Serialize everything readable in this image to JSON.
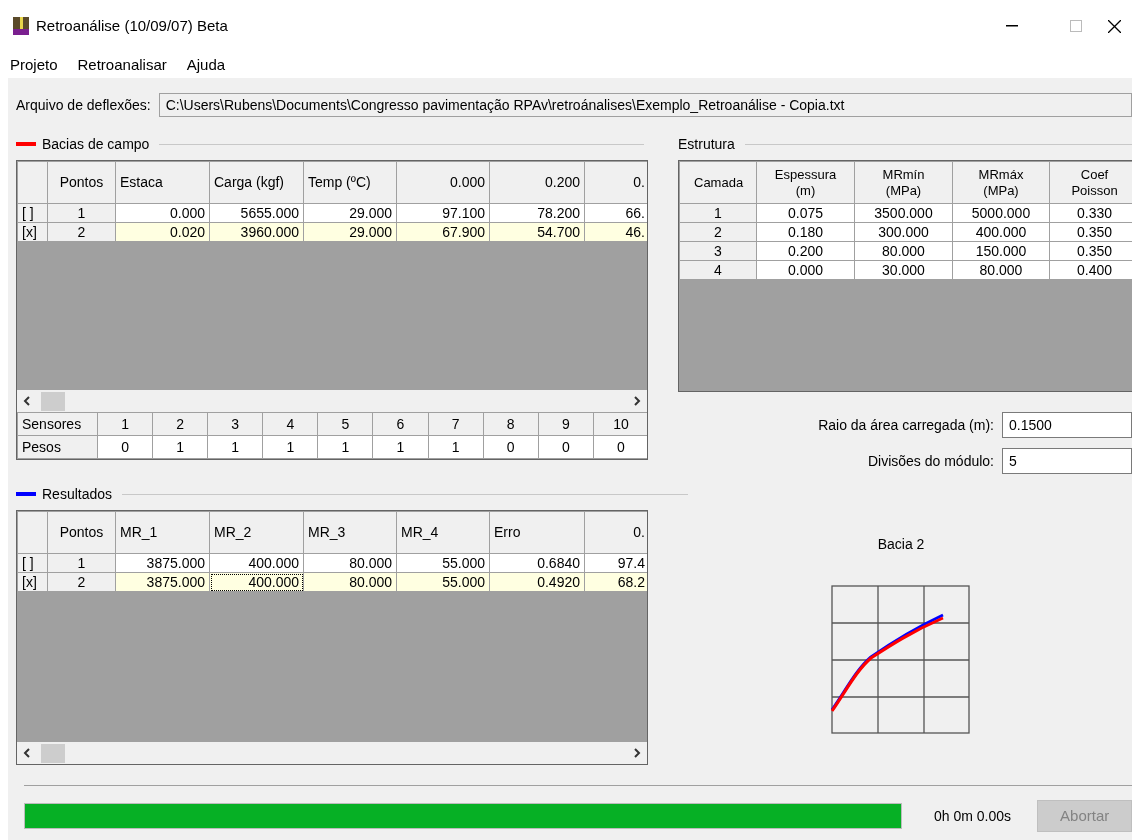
{
  "window": {
    "title": "Retroanálise (10/09/07) Beta"
  },
  "menu": [
    "Projeto",
    "Retroanalisar",
    "Ajuda"
  ],
  "file": {
    "label": "Arquivo de deflexões:",
    "value": "C:\\Users\\Rubens\\Documents\\Congresso pavimentação RPAv\\retroánalises\\Exemplo_Retroanálise - Copia.txt"
  },
  "field_basins": {
    "title": "Bacias de campo",
    "columns": [
      "Pontos",
      "Estaca",
      "Carga (kgf)",
      "Temp (ºC)",
      "0.000",
      "0.200",
      "0."
    ],
    "rows": [
      {
        "mark": "[ ]",
        "selected": false,
        "cells": [
          "1",
          "0.000",
          "5655.000",
          "29.000",
          "97.100",
          "78.200",
          "66."
        ]
      },
      {
        "mark": "[x]",
        "selected": true,
        "cells": [
          "2",
          "0.020",
          "3960.000",
          "29.000",
          "67.900",
          "54.700",
          "46."
        ]
      }
    ],
    "sensors": {
      "label": "Sensores",
      "values": [
        "1",
        "2",
        "3",
        "4",
        "5",
        "6",
        "7",
        "8",
        "9",
        "10"
      ]
    },
    "weights": {
      "label": "Pesos",
      "values": [
        "0",
        "1",
        "1",
        "1",
        "1",
        "1",
        "1",
        "0",
        "0",
        "0"
      ]
    }
  },
  "structure": {
    "title": "Estrutura",
    "columns": [
      "Camada",
      "Espessura (m)",
      "MRmín (MPa)",
      "MRmáx (MPa)",
      "Coef Poisson"
    ],
    "rows": [
      [
        "1",
        "0.075",
        "3500.000",
        "5000.000",
        "0.330"
      ],
      [
        "2",
        "0.180",
        "300.000",
        "400.000",
        "0.350"
      ],
      [
        "3",
        "0.200",
        "80.000",
        "150.000",
        "0.350"
      ],
      [
        "4",
        "0.000",
        "30.000",
        "80.000",
        "0.400"
      ]
    ],
    "load_radius": {
      "label": "Raio da área carregada (m):",
      "value": "0.1500"
    },
    "module_divisions": {
      "label": "Divisões do módulo:",
      "value": "5"
    }
  },
  "results": {
    "title": "Resultados",
    "columns": [
      "Pontos",
      "MR_1",
      "MR_2",
      "MR_3",
      "MR_4",
      "Erro",
      "0."
    ],
    "rows": [
      {
        "mark": "[ ]",
        "selected": false,
        "cells": [
          {
            "text": "1",
            "focused": false
          },
          {
            "text": "3875.000",
            "focused": false
          },
          {
            "text": "400.000",
            "focused": false
          },
          {
            "text": "80.000",
            "focused": false
          },
          {
            "text": "55.000",
            "focused": false
          },
          {
            "text": "0.6840",
            "focused": false
          },
          {
            "text": "97.4",
            "focused": false
          }
        ]
      },
      {
        "mark": "[x]",
        "selected": true,
        "cells": [
          {
            "text": "2",
            "focused": false
          },
          {
            "text": "3875.000",
            "focused": false
          },
          {
            "text": "400.000",
            "focused": true
          },
          {
            "text": "80.000",
            "focused": false
          },
          {
            "text": "55.000",
            "focused": false
          },
          {
            "text": "0.4920",
            "focused": false
          },
          {
            "text": "68.2",
            "focused": false
          }
        ]
      }
    ]
  },
  "chart": {
    "title": "Bacia 2"
  },
  "progress": {
    "level": 1,
    "time": "0h 0m 0.00s"
  },
  "abort_button": {
    "label": "Abortar",
    "disabled": true
  }
}
